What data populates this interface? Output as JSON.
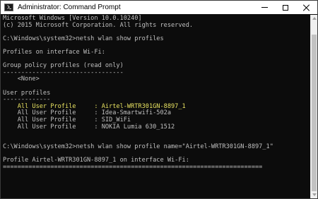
{
  "window": {
    "title": "Administrator: Command Prompt"
  },
  "console": {
    "lines": [
      {
        "text": "Microsoft Windows [Version 10.0.10240]"
      },
      {
        "text": "(c) 2015 Microsoft Corporation. All rights reserved."
      },
      {
        "text": ""
      },
      {
        "text": "C:\\Windows\\system32>netsh wlan show profiles"
      },
      {
        "text": ""
      },
      {
        "text": "Profiles on interface Wi-Fi:"
      },
      {
        "text": ""
      },
      {
        "text": "Group policy profiles (read only)"
      },
      {
        "text": "---------------------------------"
      },
      {
        "text": "    <None>"
      },
      {
        "text": ""
      },
      {
        "text": "User profiles"
      },
      {
        "text": "-------------"
      },
      {
        "text": "    All User Profile     : Airtel-WRTR301GN-8897_1"
      },
      {
        "text": "    All User Profile     : Idea-Smartwifi-502a"
      },
      {
        "text": "    All User Profile     : SID_WiFi"
      },
      {
        "text": "    All User Profile     : NOKIA Lumia 630_1512"
      },
      {
        "text": ""
      },
      {
        "text": ""
      },
      {
        "text": "C:\\Windows\\system32>netsh wlan show profile name=\"Airtel-WRTR301GN-8897_1\""
      },
      {
        "text": ""
      },
      {
        "text": "Profile Airtel-WRTR301GN-8897_1 on interface Wi-Fi:"
      },
      {
        "text": "======================================================================="
      }
    ],
    "highlight_line_index": 13,
    "text_color": "#c0c0c0",
    "highlight_color": "#e9e361",
    "background_color": "#0c0c0c"
  }
}
